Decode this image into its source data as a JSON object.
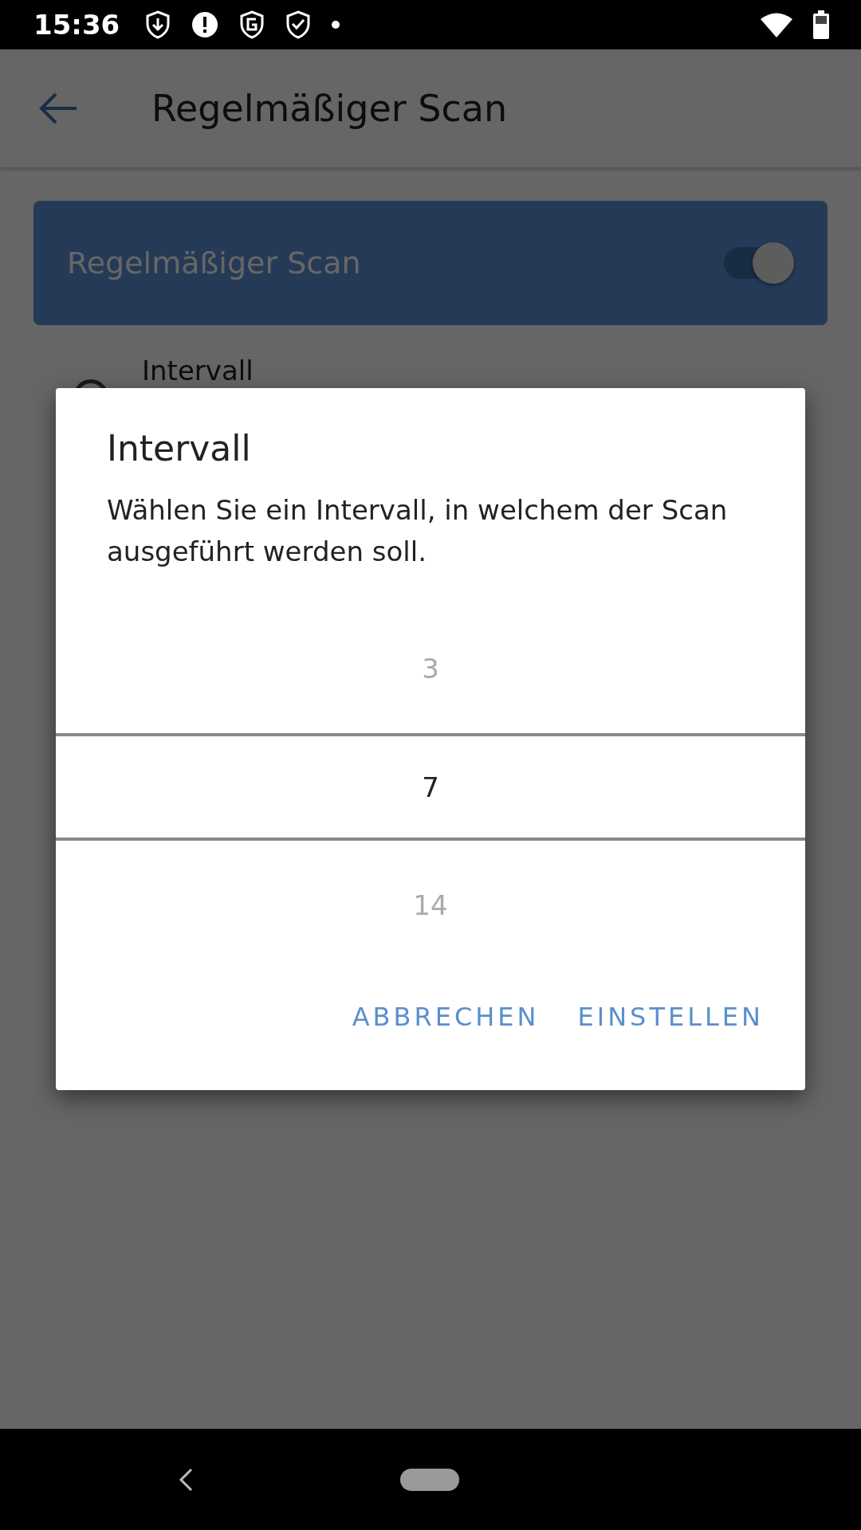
{
  "status_bar": {
    "time": "15:36"
  },
  "app_bar": {
    "title": "Regelmäßiger Scan"
  },
  "master_switch": {
    "label": "Regelmäßiger Scan",
    "on": true
  },
  "settings": [
    {
      "title": "Intervall"
    }
  ],
  "dialog": {
    "title": "Intervall",
    "message": "Wählen Sie ein Intervall, in welchem der Scan ausgeführt werden soll.",
    "picker": [
      {
        "label": "3",
        "selected": false
      },
      {
        "label": "7",
        "selected": true
      },
      {
        "label": "14",
        "selected": false
      }
    ],
    "buttons": [
      "ABBRECHEN",
      "EINSTELLEN"
    ]
  }
}
